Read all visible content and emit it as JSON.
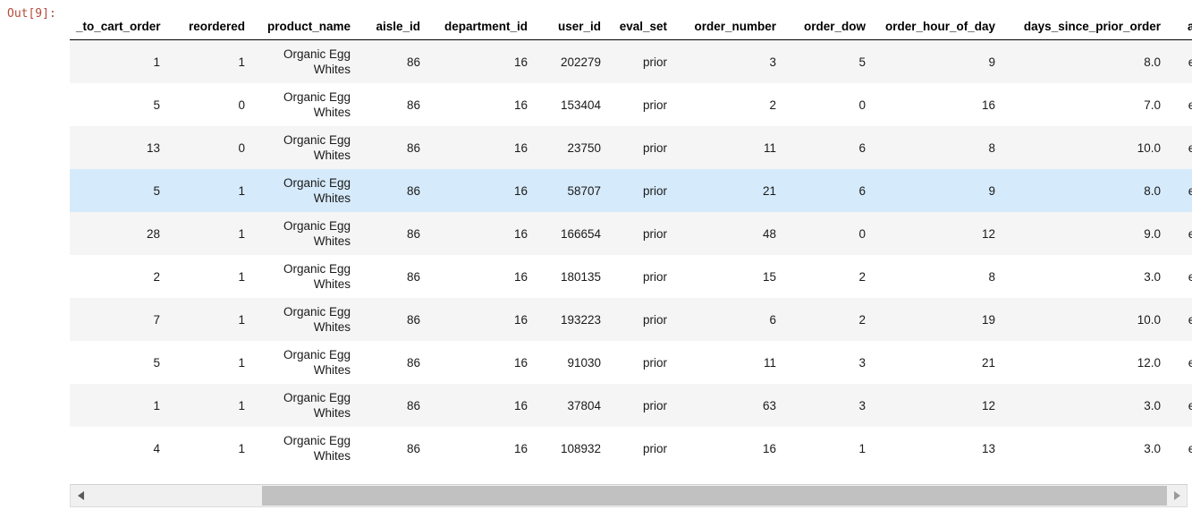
{
  "prompt": {
    "label": "Out[9]:",
    "color": "#b54a3a"
  },
  "table": {
    "columns": [
      "_to_cart_order",
      "reordered",
      "product_name",
      "aisle_id",
      "department_id",
      "user_id",
      "eval_set",
      "order_number",
      "order_dow",
      "order_hour_of_day",
      "days_since_prior_order",
      "aisle"
    ],
    "rows": [
      {
        "add_to_cart_order": "1",
        "reordered": "1",
        "product_name": "Organic Egg Whites",
        "aisle_id": "86",
        "department_id": "16",
        "user_id": "202279",
        "eval_set": "prior",
        "order_number": "3",
        "order_dow": "5",
        "order_hour_of_day": "9",
        "days_since_prior_order": "8.0",
        "aisle": "eggs",
        "highlighted": false
      },
      {
        "add_to_cart_order": "5",
        "reordered": "0",
        "product_name": "Organic Egg Whites",
        "aisle_id": "86",
        "department_id": "16",
        "user_id": "153404",
        "eval_set": "prior",
        "order_number": "2",
        "order_dow": "0",
        "order_hour_of_day": "16",
        "days_since_prior_order": "7.0",
        "aisle": "eggs",
        "highlighted": false
      },
      {
        "add_to_cart_order": "13",
        "reordered": "0",
        "product_name": "Organic Egg Whites",
        "aisle_id": "86",
        "department_id": "16",
        "user_id": "23750",
        "eval_set": "prior",
        "order_number": "11",
        "order_dow": "6",
        "order_hour_of_day": "8",
        "days_since_prior_order": "10.0",
        "aisle": "eggs",
        "highlighted": false
      },
      {
        "add_to_cart_order": "5",
        "reordered": "1",
        "product_name": "Organic Egg Whites",
        "aisle_id": "86",
        "department_id": "16",
        "user_id": "58707",
        "eval_set": "prior",
        "order_number": "21",
        "order_dow": "6",
        "order_hour_of_day": "9",
        "days_since_prior_order": "8.0",
        "aisle": "eggs",
        "highlighted": true
      },
      {
        "add_to_cart_order": "28",
        "reordered": "1",
        "product_name": "Organic Egg Whites",
        "aisle_id": "86",
        "department_id": "16",
        "user_id": "166654",
        "eval_set": "prior",
        "order_number": "48",
        "order_dow": "0",
        "order_hour_of_day": "12",
        "days_since_prior_order": "9.0",
        "aisle": "eggs",
        "highlighted": false
      },
      {
        "add_to_cart_order": "2",
        "reordered": "1",
        "product_name": "Organic Egg Whites",
        "aisle_id": "86",
        "department_id": "16",
        "user_id": "180135",
        "eval_set": "prior",
        "order_number": "15",
        "order_dow": "2",
        "order_hour_of_day": "8",
        "days_since_prior_order": "3.0",
        "aisle": "eggs",
        "highlighted": false
      },
      {
        "add_to_cart_order": "7",
        "reordered": "1",
        "product_name": "Organic Egg Whites",
        "aisle_id": "86",
        "department_id": "16",
        "user_id": "193223",
        "eval_set": "prior",
        "order_number": "6",
        "order_dow": "2",
        "order_hour_of_day": "19",
        "days_since_prior_order": "10.0",
        "aisle": "eggs",
        "highlighted": false
      },
      {
        "add_to_cart_order": "5",
        "reordered": "1",
        "product_name": "Organic Egg Whites",
        "aisle_id": "86",
        "department_id": "16",
        "user_id": "91030",
        "eval_set": "prior",
        "order_number": "11",
        "order_dow": "3",
        "order_hour_of_day": "21",
        "days_since_prior_order": "12.0",
        "aisle": "eggs",
        "highlighted": false
      },
      {
        "add_to_cart_order": "1",
        "reordered": "1",
        "product_name": "Organic Egg Whites",
        "aisle_id": "86",
        "department_id": "16",
        "user_id": "37804",
        "eval_set": "prior",
        "order_number": "63",
        "order_dow": "3",
        "order_hour_of_day": "12",
        "days_since_prior_order": "3.0",
        "aisle": "eggs",
        "highlighted": false
      },
      {
        "add_to_cart_order": "4",
        "reordered": "1",
        "product_name": "Organic Egg Whites",
        "aisle_id": "86",
        "department_id": "16",
        "user_id": "108932",
        "eval_set": "prior",
        "order_number": "16",
        "order_dow": "1",
        "order_hour_of_day": "13",
        "days_since_prior_order": "3.0",
        "aisle": "eggs",
        "highlighted": false
      }
    ],
    "highlight_color": "#d5eafb",
    "stripe_color": "#f5f5f5"
  },
  "scrollbar": {
    "orientation": "horizontal",
    "left_arrow": "◀",
    "right_arrow": "▶",
    "thumb_color": "#c1c1c1",
    "track_color": "#f0f0f0"
  }
}
